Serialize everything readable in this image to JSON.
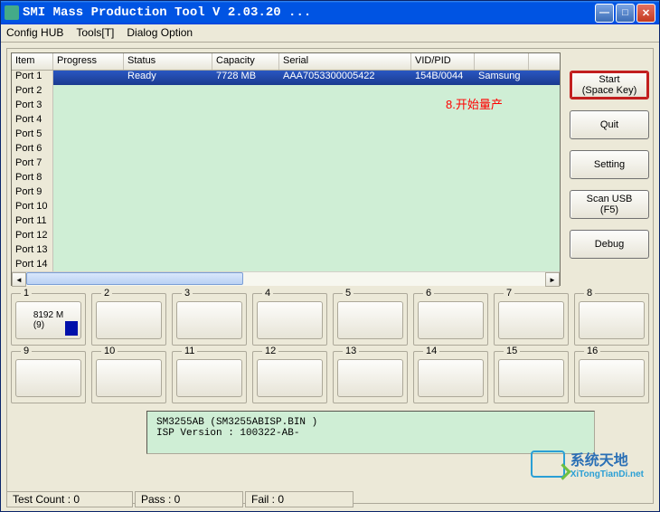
{
  "titlebar": {
    "text": "SMI Mass Production Tool        V 2.03.20   ..."
  },
  "menu": {
    "config": "Config HUB",
    "tools": "Tools[T]",
    "dialog": "Dialog Option"
  },
  "table": {
    "headers": {
      "item": "Item",
      "progress": "Progress",
      "status": "Status",
      "capacity": "Capacity",
      "serial": "Serial",
      "vidpid": "VID/PID",
      "extra": ""
    },
    "rows": [
      {
        "item": "Port 1",
        "progress": "",
        "status": "Ready",
        "capacity": "7728 MB",
        "serial": "AAA7053300005422",
        "vidpid": "154B/0044",
        "extra": "Samsung",
        "selected": true
      },
      {
        "item": "Port 2"
      },
      {
        "item": "Port 3"
      },
      {
        "item": "Port 4"
      },
      {
        "item": "Port 5"
      },
      {
        "item": "Port 6"
      },
      {
        "item": "Port 7"
      },
      {
        "item": "Port 8"
      },
      {
        "item": "Port 9"
      },
      {
        "item": "Port 10"
      },
      {
        "item": "Port 11"
      },
      {
        "item": "Port 12"
      },
      {
        "item": "Port 13"
      },
      {
        "item": "Port 14"
      }
    ]
  },
  "buttons": {
    "start": "Start\n(Space Key)",
    "quit": "Quit",
    "setting": "Setting",
    "scan": "Scan USB\n(F5)",
    "debug": "Debug"
  },
  "annotation": "8.开始量产",
  "slots": [
    {
      "n": "1",
      "text": "8192 M\n(9)",
      "block": true
    },
    {
      "n": "2"
    },
    {
      "n": "3"
    },
    {
      "n": "4"
    },
    {
      "n": "5"
    },
    {
      "n": "6"
    },
    {
      "n": "7"
    },
    {
      "n": "8"
    },
    {
      "n": "9"
    },
    {
      "n": "10"
    },
    {
      "n": "11"
    },
    {
      "n": "12"
    },
    {
      "n": "13"
    },
    {
      "n": "14"
    },
    {
      "n": "15"
    },
    {
      "n": "16"
    }
  ],
  "info": {
    "line1": "SM3255AB      (SM3255ABISP.BIN )",
    "line2": "ISP Version :    100322-AB-"
  },
  "status": {
    "test": "Test Count :  0",
    "pass": "Pass :  0",
    "fail": "Fail :  0"
  },
  "watermark": {
    "text": "系统天地",
    "url": "XiTongTianDi.net"
  }
}
